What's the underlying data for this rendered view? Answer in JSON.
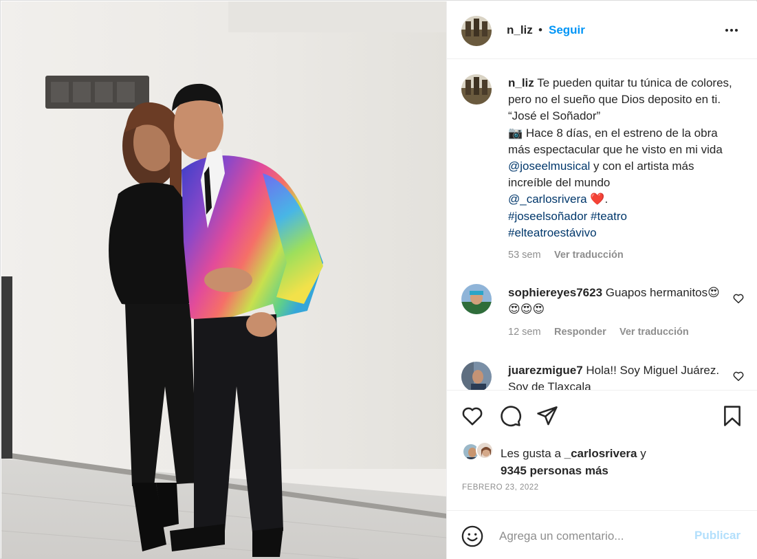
{
  "post": {
    "username": "n_liz",
    "dot": "•",
    "follow_label": "Seguir",
    "caption": {
      "line1": "Te pueden quitar tu túnica de colores, pero no el sueño que Dios deposito en ti. “José el Soñador”",
      "camera_emoji": "📷",
      "line2": "Hace 8 días, en el estreno de la obra más espectacular que he visto en mi vida",
      "mention1": "@joseelmusical",
      "line3": "y con el artista más increíble del mundo",
      "mention2": "@_carlosrivera",
      "heart_emoji": "❤️",
      "period": ".",
      "hashtag1": "#joseelsoñador",
      "hashtag2": "#teatro",
      "hashtag3": "#elteatroestávivo",
      "time": "53 sem",
      "translate": "Ver traducción"
    },
    "comments": [
      {
        "username": "sophiereyes7623",
        "text": "Guapos hermanitos😍😍😍😍",
        "time": "12 sem",
        "reply": "Responder",
        "translate": "Ver traducción"
      },
      {
        "username": "juarezmigue7",
        "text": "Hola!! Soy Miguel Juárez. Soy de Tlaxcala"
      }
    ],
    "likes": {
      "prefix": "Les gusta a",
      "user": "_carlosrivera",
      "conj": "y",
      "others": "9345 personas más"
    },
    "date": "FEBRERO 23, 2022",
    "comment_input": {
      "placeholder": "Agrega un comentario..."
    },
    "publish_label": "Publicar"
  },
  "icons": {
    "more": "more-options-icon",
    "like": "heart-icon",
    "comment": "comment-bubble-icon",
    "share": "paper-plane-icon",
    "save": "bookmark-icon",
    "emoji": "smiley-icon"
  },
  "colors": {
    "accent": "#0095f6",
    "link": "#00376b",
    "muted": "#8e8e8e",
    "publish_disabled": "#b2dffc"
  }
}
